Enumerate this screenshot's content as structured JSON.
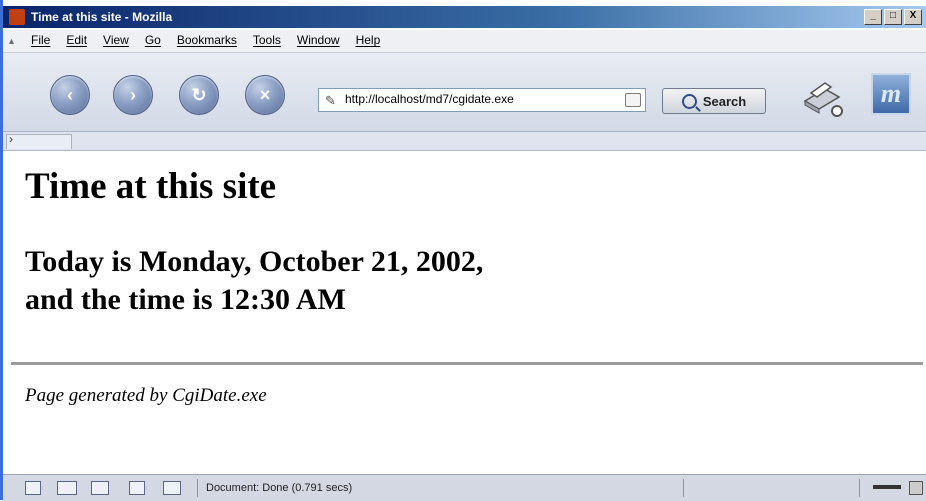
{
  "window": {
    "title": "Time at this site - Mozilla"
  },
  "window_buttons": [
    "_",
    "□",
    "X"
  ],
  "menu": [
    "File",
    "Edit",
    "View",
    "Go",
    "Bookmarks",
    "Tools",
    "Window",
    "Help"
  ],
  "nav": {
    "back_glyph": "‹",
    "forward_glyph": "›",
    "reload_glyph": "↻",
    "stop_glyph": "×",
    "url": "http://localhost/md7/cgidate.exe",
    "search_label": "Search"
  },
  "page": {
    "heading": "Time at this site",
    "line1": "Today is Monday, October 21, 2002,",
    "line2": "and the time is 12:30 AM",
    "footer": "Page generated by CgiDate.exe"
  },
  "status": {
    "text": "Document: Done (0.791 secs)"
  },
  "colors": {
    "titlebar": "#0a246a",
    "accent": "#3a6ea5"
  },
  "icons": [
    "app-icon",
    "back-icon",
    "forward-icon",
    "reload-icon",
    "stop-icon",
    "print-icon",
    "mozilla-throbber-icon",
    "search-icon"
  ]
}
